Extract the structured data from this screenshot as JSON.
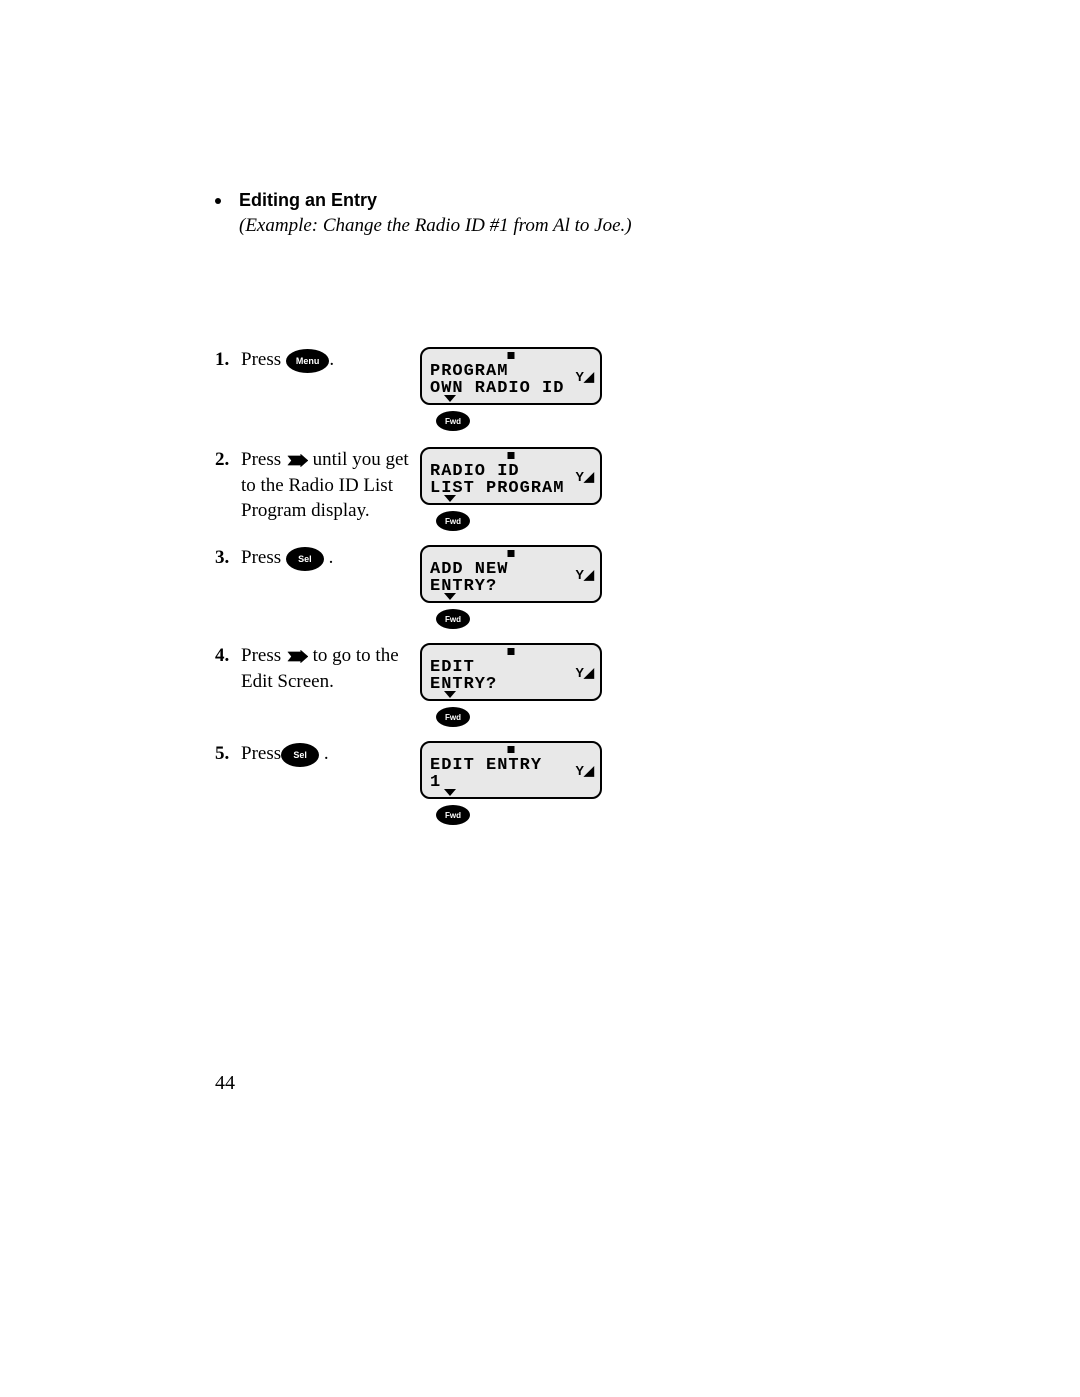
{
  "heading": "Editing an Entry",
  "example": "(Example: Change the Radio ID #1 from Al to Joe.)",
  "steps": [
    {
      "num": "1.",
      "text_before": "Press ",
      "button_label": "Menu",
      "button_type": "oval",
      "text_after": ".",
      "lcd": {
        "line1": "PROGRAM",
        "line2": "OWN RADIO ID",
        "signal": "Y◢"
      },
      "below_button": "Fwd"
    },
    {
      "num": "2.",
      "text_before": "Press ",
      "button_type": "forward",
      "text_after": " until you get to the Radio ID List Program display.",
      "lcd": {
        "line1": "RADIO ID",
        "line2": "LIST PROGRAM",
        "signal": "Y◢"
      },
      "below_button": "Fwd"
    },
    {
      "num": "3.",
      "text_before": "Press ",
      "button_label": "Sel",
      "button_type": "oval",
      "text_after": " .",
      "lcd": {
        "line1": "ADD NEW",
        "line2": "ENTRY?",
        "signal": "Y◢"
      },
      "below_button": "Fwd"
    },
    {
      "num": "4.",
      "text_before": "Press ",
      "button_type": "forward",
      "text_after": " to go to the Edit Screen.",
      "lcd": {
        "line1": "EDIT",
        "line2": "ENTRY?",
        "signal": "Y◢"
      },
      "below_button": "Fwd"
    },
    {
      "num": "5.",
      "text_before": "Press",
      "button_label": "Sel",
      "button_type": "oval",
      "text_after": " .",
      "lcd": {
        "line1": "EDIT ENTRY",
        "line2": "1",
        "signal": "Y◢"
      },
      "below_button": "Fwd"
    }
  ],
  "page_number": "44"
}
